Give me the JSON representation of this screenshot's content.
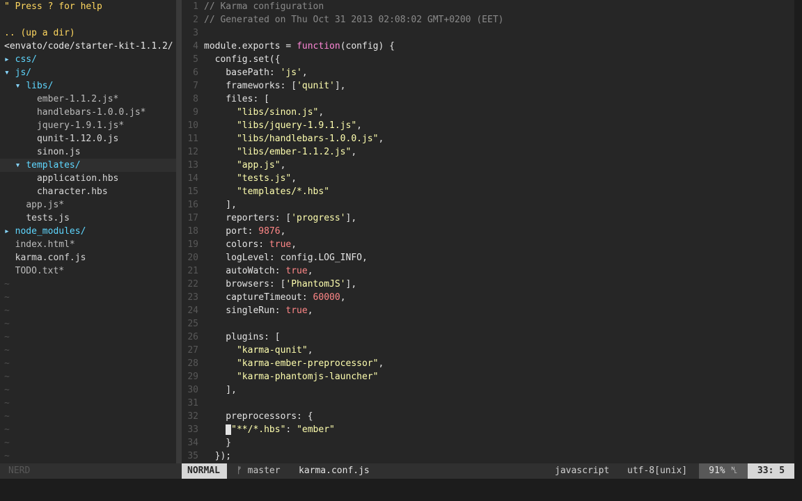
{
  "tree": {
    "help": "\" Press ? for help",
    "up_dir": ".. (up a dir)",
    "root_path": "<envato/code/starter-kit-1.1.2/",
    "entries": [
      {
        "indent": "",
        "arrow": "▸ ",
        "name": "css/",
        "kind": "dir"
      },
      {
        "indent": "",
        "arrow": "▾ ",
        "name": "js/",
        "kind": "dir"
      },
      {
        "indent": "  ",
        "arrow": "▾ ",
        "name": "libs/",
        "kind": "dir"
      },
      {
        "indent": "      ",
        "arrow": "",
        "name": "ember-1.1.2.js*",
        "kind": "exe"
      },
      {
        "indent": "      ",
        "arrow": "",
        "name": "handlebars-1.0.0.js*",
        "kind": "exe"
      },
      {
        "indent": "      ",
        "arrow": "",
        "name": "jquery-1.9.1.js*",
        "kind": "exe"
      },
      {
        "indent": "      ",
        "arrow": "",
        "name": "qunit-1.12.0.js",
        "kind": "file"
      },
      {
        "indent": "      ",
        "arrow": "",
        "name": "sinon.js",
        "kind": "file"
      },
      {
        "indent": "  ",
        "arrow": "▾ ",
        "name": "templates/",
        "kind": "dir",
        "current": true
      },
      {
        "indent": "      ",
        "arrow": "",
        "name": "application.hbs",
        "kind": "file"
      },
      {
        "indent": "      ",
        "arrow": "",
        "name": "character.hbs",
        "kind": "file"
      },
      {
        "indent": "    ",
        "arrow": "",
        "name": "app.js*",
        "kind": "exe"
      },
      {
        "indent": "    ",
        "arrow": "",
        "name": "tests.js",
        "kind": "file"
      },
      {
        "indent": "",
        "arrow": "▸ ",
        "name": "node_modules/",
        "kind": "dir"
      },
      {
        "indent": "  ",
        "arrow": "",
        "name": "index.html*",
        "kind": "exe"
      },
      {
        "indent": "  ",
        "arrow": "",
        "name": "karma.conf.js",
        "kind": "file"
      },
      {
        "indent": "  ",
        "arrow": "",
        "name": "TODO.txt*",
        "kind": "exe"
      }
    ],
    "tilde_rows": 14
  },
  "editor": {
    "cursor_line": 33,
    "lines": [
      [
        [
          "c",
          "// Karma configuration"
        ]
      ],
      [
        [
          "c",
          "// Generated on Thu Oct 31 2013 02:08:02 GMT+0200 (EET)"
        ]
      ],
      [],
      [
        [
          "p",
          "module.exports = "
        ],
        [
          "k",
          "function"
        ],
        [
          "p",
          "(config) {"
        ]
      ],
      [
        [
          "p",
          "  config.set({"
        ]
      ],
      [
        [
          "p",
          "    basePath: "
        ],
        [
          "s",
          "'js'"
        ],
        [
          "p",
          ","
        ]
      ],
      [
        [
          "p",
          "    frameworks: ["
        ],
        [
          "s",
          "'qunit'"
        ],
        [
          "p",
          "],"
        ]
      ],
      [
        [
          "p",
          "    files: ["
        ]
      ],
      [
        [
          "p",
          "      "
        ],
        [
          "s",
          "\"libs/sinon.js\""
        ],
        [
          "p",
          ","
        ]
      ],
      [
        [
          "p",
          "      "
        ],
        [
          "s",
          "\"libs/jquery-1.9.1.js\""
        ],
        [
          "p",
          ","
        ]
      ],
      [
        [
          "p",
          "      "
        ],
        [
          "s",
          "\"libs/handlebars-1.0.0.js\""
        ],
        [
          "p",
          ","
        ]
      ],
      [
        [
          "p",
          "      "
        ],
        [
          "s",
          "\"libs/ember-1.1.2.js\""
        ],
        [
          "p",
          ","
        ]
      ],
      [
        [
          "p",
          "      "
        ],
        [
          "s",
          "\"app.js\""
        ],
        [
          "p",
          ","
        ]
      ],
      [
        [
          "p",
          "      "
        ],
        [
          "s",
          "\"tests.js\""
        ],
        [
          "p",
          ","
        ]
      ],
      [
        [
          "p",
          "      "
        ],
        [
          "s",
          "\"templates/*.hbs\""
        ]
      ],
      [
        [
          "p",
          "    ],"
        ]
      ],
      [
        [
          "p",
          "    reporters: ["
        ],
        [
          "s",
          "'progress'"
        ],
        [
          "p",
          "],"
        ]
      ],
      [
        [
          "p",
          "    port: "
        ],
        [
          "n",
          "9876"
        ],
        [
          "p",
          ","
        ]
      ],
      [
        [
          "p",
          "    colors: "
        ],
        [
          "b",
          "true"
        ],
        [
          "p",
          ","
        ]
      ],
      [
        [
          "p",
          "    logLevel: config.LOG_INFO,"
        ]
      ],
      [
        [
          "p",
          "    autoWatch: "
        ],
        [
          "b",
          "true"
        ],
        [
          "p",
          ","
        ]
      ],
      [
        [
          "p",
          "    browsers: ["
        ],
        [
          "s",
          "'PhantomJS'"
        ],
        [
          "p",
          "],"
        ]
      ],
      [
        [
          "p",
          "    captureTimeout: "
        ],
        [
          "n",
          "60000"
        ],
        [
          "p",
          ","
        ]
      ],
      [
        [
          "p",
          "    singleRun: "
        ],
        [
          "b",
          "true"
        ],
        [
          "p",
          ","
        ]
      ],
      [],
      [
        [
          "p",
          "    plugins: ["
        ]
      ],
      [
        [
          "p",
          "      "
        ],
        [
          "s",
          "\"karma-qunit\""
        ],
        [
          "p",
          ","
        ]
      ],
      [
        [
          "p",
          "      "
        ],
        [
          "s",
          "\"karma-ember-preprocessor\""
        ],
        [
          "p",
          ","
        ]
      ],
      [
        [
          "p",
          "      "
        ],
        [
          "s",
          "\"karma-phantomjs-launcher\""
        ]
      ],
      [
        [
          "p",
          "    ],"
        ]
      ],
      [],
      [
        [
          "p",
          "    preprocessors: {"
        ]
      ],
      [
        [
          "p",
          "    "
        ],
        [
          "cur",
          " "
        ],
        [
          "s",
          "\"**/*.hbs\""
        ],
        [
          "p",
          ": "
        ],
        [
          "s",
          "\"ember\""
        ]
      ],
      [
        [
          "p",
          "    }"
        ]
      ],
      [
        [
          "p",
          "  });"
        ]
      ]
    ]
  },
  "status": {
    "nerd": "NERD",
    "mode": "NORMAL",
    "branch": "ᚠ master",
    "file": "karma.conf.js",
    "filetype": "javascript",
    "encoding": "utf-8[unix]",
    "percent": "91% ␤",
    "position": "33:  5"
  }
}
